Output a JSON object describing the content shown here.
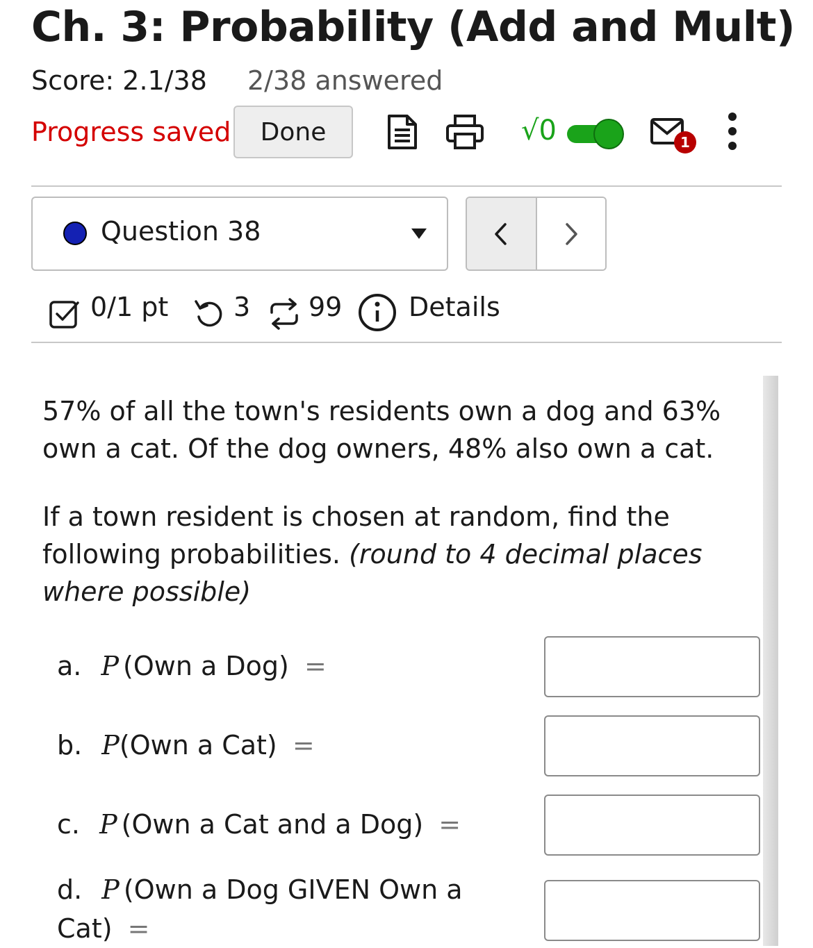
{
  "header": {
    "title": "Ch. 3: Probability (Add and Mult)",
    "score": "Score: 2.1/38",
    "answered": "2/38 answered",
    "progress_status": "Progress saved",
    "done_label": "Done",
    "message_count": "1"
  },
  "toolbar_icons": [
    "notes-icon",
    "print-icon",
    "math-sqrt-icon",
    "toggle-switch",
    "message-icon",
    "more-vertical-icon"
  ],
  "math_toggle": {
    "label": "√0",
    "on": true,
    "color": "#1aa31a"
  },
  "question_nav": {
    "selected": "Question 38",
    "prev_label": "<",
    "next_label": ">"
  },
  "question_meta": {
    "points": "0/1 pt",
    "retries": "3",
    "versions": "99",
    "details_label": "Details"
  },
  "question": {
    "paragraph1": "57% of all the town's residents own a dog and 63% own a cat. Of the dog owners, 48% also own a cat.",
    "paragraph2_plain": "If a town resident is chosen at random, find the following probabilities.",
    "paragraph2_italic": "(round to 4 decimal places where possible)",
    "parts": [
      {
        "letter": "a.",
        "P": "P",
        "text": "(Own a Dog)",
        "eq": "=",
        "value": ""
      },
      {
        "letter": "b.",
        "P": "P",
        "text": "(Own a Cat)",
        "eq": "=",
        "value": ""
      },
      {
        "letter": "c.",
        "P": "P",
        "text": "(Own a Cat and a Dog)",
        "eq": "=",
        "value": ""
      },
      {
        "letter": "d.",
        "P": "P",
        "text_line1": "(Own a Dog GIVEN Own a",
        "text_line2": "Cat)",
        "eq": "=",
        "value": ""
      }
    ]
  },
  "colors": {
    "progress_saved": "#d40000",
    "question_dot": "#1421b3",
    "toggle_on": "#1aa31a",
    "badge": "#b80000"
  }
}
